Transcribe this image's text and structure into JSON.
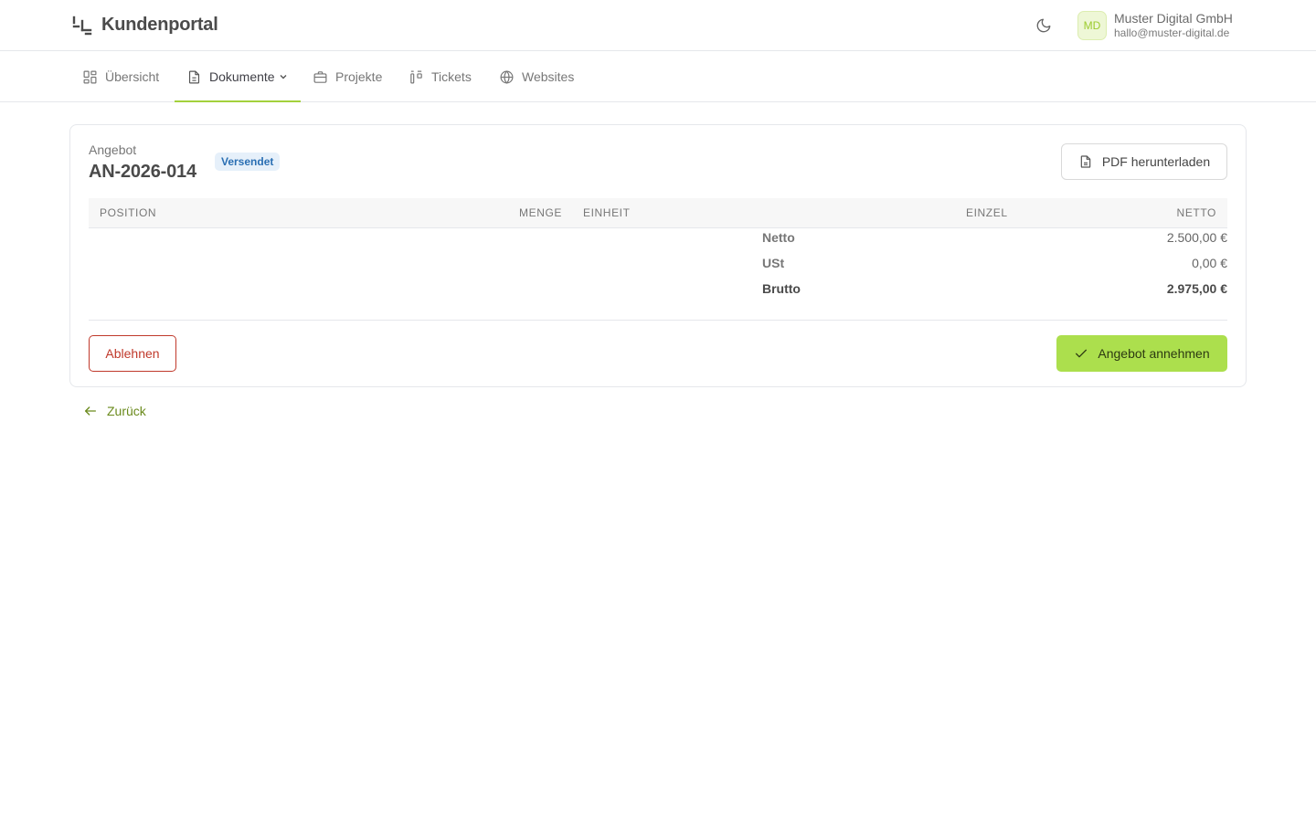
{
  "header": {
    "app_title": "Kundenportal",
    "user": {
      "initials": "MD",
      "name": "Muster Digital GmbH",
      "email": "hallo@muster-digital.de"
    }
  },
  "nav": {
    "items": [
      {
        "label": "Übersicht",
        "icon": "dashboard-icon"
      },
      {
        "label": "Dokumente",
        "icon": "document-icon",
        "active": true,
        "has_dropdown": true
      },
      {
        "label": "Projekte",
        "icon": "briefcase-icon"
      },
      {
        "label": "Tickets",
        "icon": "kanban-icon"
      },
      {
        "label": "Websites",
        "icon": "globe-icon"
      }
    ]
  },
  "document": {
    "type": "Angebot",
    "number": "AN-2026-014",
    "status": "Versendet",
    "pdf_button": "PDF herunterladen"
  },
  "table": {
    "columns": [
      "Position",
      "Menge",
      "Einheit",
      "Einzel",
      "Netto"
    ]
  },
  "summary": [
    {
      "label": "Netto",
      "value": "2.500,00 €"
    },
    {
      "label": "USt",
      "value": "0,00 €"
    },
    {
      "label": "Brutto",
      "value": "2.975,00 €",
      "total": true
    }
  ],
  "actions": {
    "reject": "Ablehnen",
    "accept": "Angebot annehmen"
  },
  "back_link": "Zurück",
  "colors": {
    "accent": "#acdf4d",
    "nav_underline": "#a3d13c",
    "danger": "#c0392b",
    "badge_bg": "#e6f0fa",
    "badge_text": "#2a6fb3",
    "link": "#6a8a1c"
  }
}
